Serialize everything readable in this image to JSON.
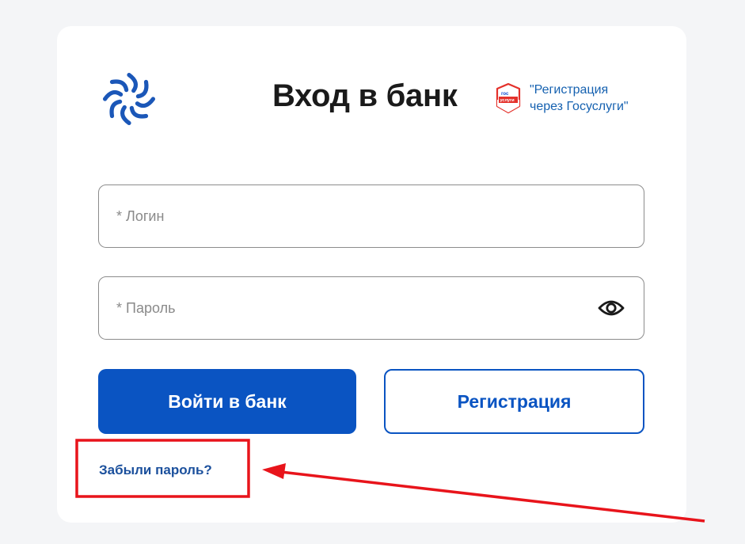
{
  "header": {
    "title": "Вход в банк",
    "gosuslugi_badge_text": "гос услуги",
    "gosuslugi_link": "\"Регистрация\nчерез Госуслуги\""
  },
  "form": {
    "login_placeholder": "* Логин",
    "login_value": "",
    "password_placeholder": "* Пароль",
    "password_value": ""
  },
  "actions": {
    "login_button": "Войти в банк",
    "register_button": "Регистрация",
    "forgot_password": "Забыли пароль?"
  },
  "icons": {
    "logo": "bank-logo-icon",
    "gosuslugi": "gosuslugi-icon",
    "password_toggle": "eye-icon"
  },
  "colors": {
    "primary": "#0a54c2",
    "link": "#1561b0",
    "annotation": "#e8141b"
  }
}
